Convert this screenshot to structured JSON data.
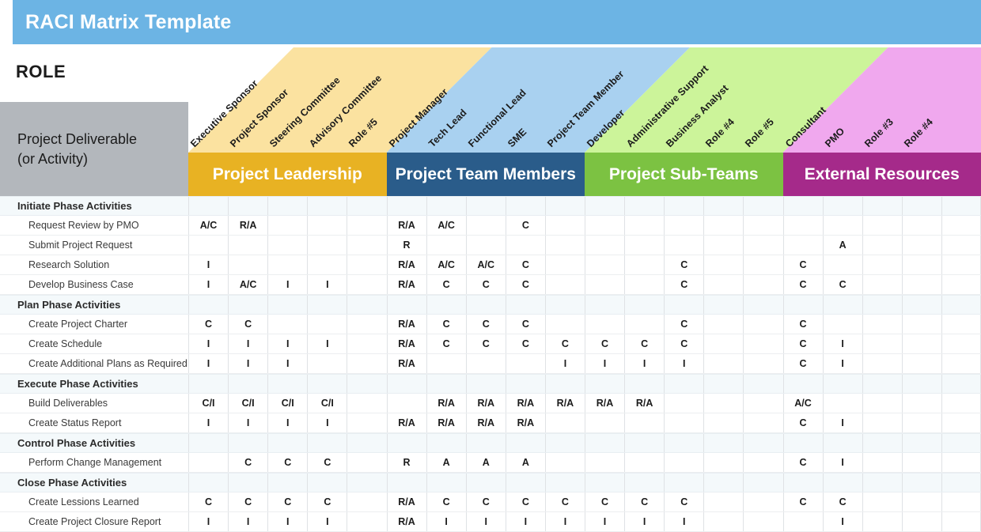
{
  "title": "RACI Matrix Template",
  "role_label": "ROLE",
  "deliverable_header": "Project Deliverable\n(or Activity)",
  "colors": {
    "title_bar": "#6cb4e4",
    "deliverable_box": "#b3b7bc",
    "leadership_band": "#e8b223",
    "leadership_wedge": "#fbe2a0",
    "team_band": "#2a5c8a",
    "team_wedge": "#a9d1f0",
    "subteam_band": "#7cc242",
    "subteam_wedge": "#ccf49a",
    "external_band": "#a52a8a",
    "external_wedge": "#f0a8ee",
    "grid_line": "#dfe2e5",
    "phase_row": "#f4f9fb"
  },
  "groups": [
    {
      "label": "Project Leadership",
      "span": 5,
      "band": "#e8b223",
      "wedge": "#fbe2a0"
    },
    {
      "label": "Project Team Members",
      "span": 5,
      "band": "#2a5c8a",
      "wedge": "#a9d1f0"
    },
    {
      "label": "Project Sub-Teams",
      "span": 5,
      "band": "#7cc242",
      "wedge": "#ccf49a"
    },
    {
      "label": "External Resources",
      "span": 5,
      "band": "#a52a8a",
      "wedge": "#f0a8ee"
    }
  ],
  "columns": [
    "Executive Sponsor",
    "Project Sponsor",
    "Steering Committee",
    "Advisory Committee",
    "Role #5",
    "Project Manager",
    "Tech Lead",
    "Functional Lead",
    "SME",
    "Project Team Member",
    "Developer",
    "Administrative Support",
    "Business Analyst",
    "Role #4",
    "Role #5",
    "Consultant",
    "PMO",
    "Role #3",
    "Role #4",
    ""
  ],
  "rows": [
    {
      "type": "phase",
      "label": "Initiate Phase Activities",
      "values": [
        "",
        "",
        "",
        "",
        "",
        "",
        "",
        "",
        "",
        "",
        "",
        "",
        "",
        "",
        "",
        "",
        "",
        "",
        "",
        ""
      ]
    },
    {
      "type": "task",
      "label": "Request Review by PMO",
      "values": [
        "A/C",
        "R/A",
        "",
        "",
        "",
        "R/A",
        "A/C",
        "",
        "C",
        "",
        "",
        "",
        "",
        "",
        "",
        "",
        "",
        "",
        "",
        ""
      ]
    },
    {
      "type": "task",
      "label": "Submit Project Request",
      "values": [
        "",
        "",
        "",
        "",
        "",
        "R",
        "",
        "",
        "",
        "",
        "",
        "",
        "",
        "",
        "",
        "",
        "A",
        "",
        "",
        ""
      ]
    },
    {
      "type": "task",
      "label": "Research Solution",
      "values": [
        "I",
        "",
        "",
        "",
        "",
        "R/A",
        "A/C",
        "A/C",
        "C",
        "",
        "",
        "",
        "C",
        "",
        "",
        "C",
        "",
        "",
        "",
        ""
      ]
    },
    {
      "type": "task",
      "label": "Develop Business Case",
      "values": [
        "I",
        "A/C",
        "I",
        "I",
        "",
        "R/A",
        "C",
        "C",
        "C",
        "",
        "",
        "",
        "C",
        "",
        "",
        "C",
        "C",
        "",
        "",
        ""
      ]
    },
    {
      "type": "phase",
      "label": "Plan Phase Activities",
      "values": [
        "",
        "",
        "",
        "",
        "",
        "",
        "",
        "",
        "",
        "",
        "",
        "",
        "",
        "",
        "",
        "",
        "",
        "",
        "",
        ""
      ]
    },
    {
      "type": "task",
      "label": "Create Project Charter",
      "values": [
        "C",
        "C",
        "",
        "",
        "",
        "R/A",
        "C",
        "C",
        "C",
        "",
        "",
        "",
        "C",
        "",
        "",
        "C",
        "",
        "",
        "",
        ""
      ]
    },
    {
      "type": "task",
      "label": "Create Schedule",
      "values": [
        "I",
        "I",
        "I",
        "I",
        "",
        "R/A",
        "C",
        "C",
        "C",
        "C",
        "C",
        "C",
        "C",
        "",
        "",
        "C",
        "I",
        "",
        "",
        ""
      ]
    },
    {
      "type": "task",
      "label": "Create Additional Plans as Required",
      "values": [
        "I",
        "I",
        "I",
        "",
        "",
        "R/A",
        "",
        "",
        "",
        "I",
        "I",
        "I",
        "I",
        "",
        "",
        "C",
        "I",
        "",
        "",
        ""
      ]
    },
    {
      "type": "phase",
      "label": "Execute Phase Activities",
      "values": [
        "",
        "",
        "",
        "",
        "",
        "",
        "",
        "",
        "",
        "",
        "",
        "",
        "",
        "",
        "",
        "",
        "",
        "",
        "",
        ""
      ]
    },
    {
      "type": "task",
      "label": "Build Deliverables",
      "values": [
        "C/I",
        "C/I",
        "C/I",
        "C/I",
        "",
        "",
        "R/A",
        "R/A",
        "R/A",
        "R/A",
        "R/A",
        "R/A",
        "",
        "",
        "",
        "A/C",
        "",
        "",
        "",
        ""
      ]
    },
    {
      "type": "task",
      "label": "Create Status Report",
      "values": [
        "I",
        "I",
        "I",
        "I",
        "",
        "R/A",
        "R/A",
        "R/A",
        "R/A",
        "",
        "",
        "",
        "",
        "",
        "",
        "C",
        "I",
        "",
        "",
        ""
      ]
    },
    {
      "type": "phase",
      "label": "Control Phase Activities",
      "values": [
        "",
        "",
        "",
        "",
        "",
        "",
        "",
        "",
        "",
        "",
        "",
        "",
        "",
        "",
        "",
        "",
        "",
        "",
        "",
        ""
      ]
    },
    {
      "type": "task",
      "label": "Perform Change Management",
      "values": [
        "",
        "C",
        "C",
        "C",
        "",
        "R",
        "A",
        "A",
        "A",
        "",
        "",
        "",
        "",
        "",
        "",
        "C",
        "I",
        "",
        "",
        ""
      ]
    },
    {
      "type": "phase",
      "label": "Close Phase Activities",
      "values": [
        "",
        "",
        "",
        "",
        "",
        "",
        "",
        "",
        "",
        "",
        "",
        "",
        "",
        "",
        "",
        "",
        "",
        "",
        "",
        ""
      ]
    },
    {
      "type": "task",
      "label": "Create Lessions Learned",
      "values": [
        "C",
        "C",
        "C",
        "C",
        "",
        "R/A",
        "C",
        "C",
        "C",
        "C",
        "C",
        "C",
        "C",
        "",
        "",
        "C",
        "C",
        "",
        "",
        ""
      ]
    },
    {
      "type": "task",
      "label": "Create Project Closure Report",
      "values": [
        "I",
        "I",
        "I",
        "I",
        "",
        "R/A",
        "I",
        "I",
        "I",
        "I",
        "I",
        "I",
        "I",
        "",
        "",
        "",
        "I",
        "",
        "",
        ""
      ]
    }
  ]
}
